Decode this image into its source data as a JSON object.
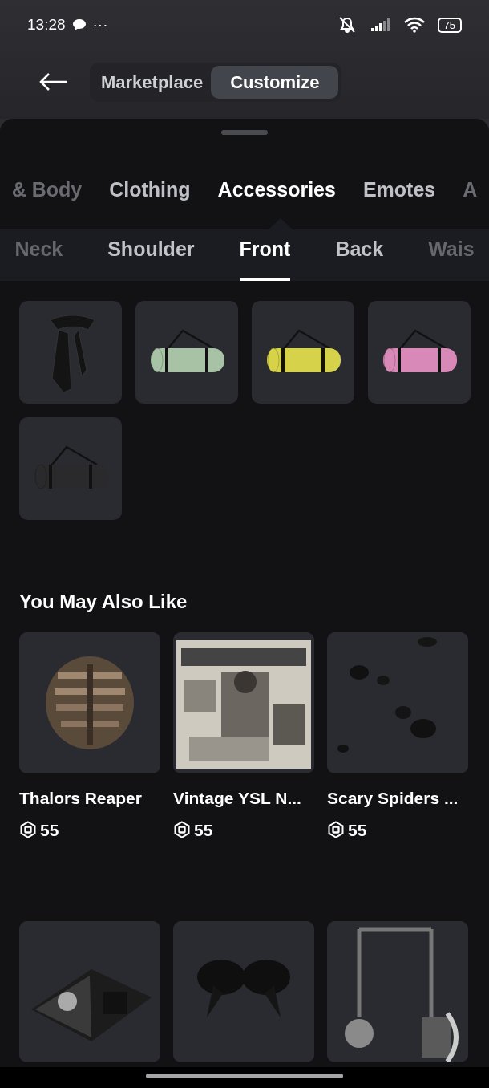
{
  "status_bar": {
    "time": "13:28",
    "more": "···",
    "battery": "75"
  },
  "header": {
    "segments": [
      {
        "label": "Marketplace",
        "selected": false
      },
      {
        "label": "Customize",
        "selected": true
      }
    ]
  },
  "categories": [
    {
      "label": "& Body",
      "selected": false,
      "faded": true
    },
    {
      "label": "Clothing",
      "selected": false,
      "faded": false
    },
    {
      "label": "Accessories",
      "selected": true,
      "faded": false
    },
    {
      "label": "Emotes",
      "selected": false,
      "faded": false
    },
    {
      "label": "A",
      "selected": false,
      "faded": true
    }
  ],
  "subcategories": [
    {
      "label": "Neck",
      "selected": false,
      "faded": true
    },
    {
      "label": "Shoulder",
      "selected": false,
      "faded": false
    },
    {
      "label": "Front",
      "selected": true,
      "faded": false
    },
    {
      "label": "Back",
      "selected": false,
      "faded": false
    },
    {
      "label": "Wais",
      "selected": false,
      "faded": true
    }
  ],
  "items": [
    {
      "kind": "scarf"
    },
    {
      "kind": "mat",
      "color": "#a8c2a6"
    },
    {
      "kind": "mat",
      "color": "#d6d24a"
    },
    {
      "kind": "mat",
      "color": "#d889b8"
    },
    {
      "kind": "mat",
      "color": "#2a2a2c"
    }
  ],
  "recommendations": {
    "title": "You May Also Like",
    "cards": [
      {
        "kind": "picture",
        "name": "Thalors Reaper",
        "price": "55"
      },
      {
        "kind": "picture",
        "name": "Vintage YSL N...",
        "price": "55"
      },
      {
        "kind": "picture",
        "name": "Scary Spiders ...",
        "price": "55"
      },
      {
        "kind": "picture"
      },
      {
        "kind": "picture"
      },
      {
        "kind": "picture"
      }
    ]
  }
}
